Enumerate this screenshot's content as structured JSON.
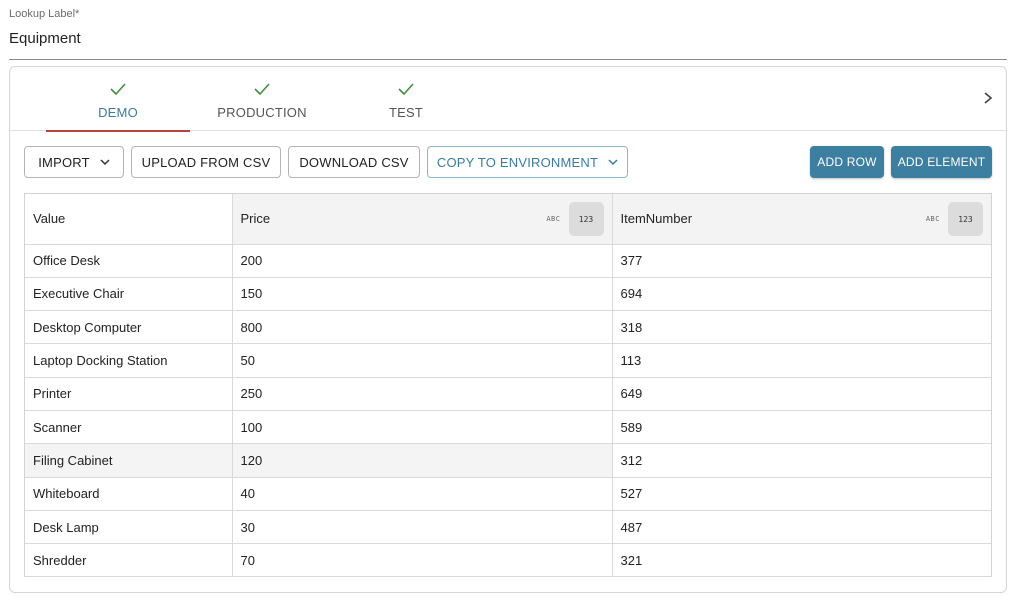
{
  "lookup": {
    "caption": "Lookup Label*",
    "value": "Equipment"
  },
  "tabs": [
    {
      "label": "DEMO",
      "icon": "check-icon",
      "active": true
    },
    {
      "label": "PRODUCTION",
      "icon": "check-icon",
      "active": false
    },
    {
      "label": "TEST",
      "icon": "check-icon",
      "active": false
    }
  ],
  "toolbar": {
    "import_label": "IMPORT",
    "upload_label": "UPLOAD FROM CSV",
    "download_label": "DOWNLOAD CSV",
    "copy_label": "COPY TO ENVIRONMENT",
    "add_row_label": "ADD ROW",
    "add_element_label": "ADD ELEMENT"
  },
  "colors": {
    "accent": "#3d7fa0",
    "active_tab_underline": "#b94141",
    "check": "#3f8f3f"
  },
  "table": {
    "columns": [
      {
        "label": "Value"
      },
      {
        "label": "Price",
        "type_abc": "ABC",
        "type_num": "123"
      },
      {
        "label": "ItemNumber",
        "type_abc": "ABC",
        "type_num": "123"
      }
    ],
    "rows": [
      [
        "Office Desk",
        "200",
        "377"
      ],
      [
        "Executive Chair",
        "150",
        "694"
      ],
      [
        "Desktop Computer",
        "800",
        "318"
      ],
      [
        "Laptop Docking Station",
        "50",
        "113"
      ],
      [
        "Printer",
        "250",
        "649"
      ],
      [
        "Scanner",
        "100",
        "589"
      ],
      [
        "Filing Cabinet",
        "120",
        "312"
      ],
      [
        "Whiteboard",
        "40",
        "527"
      ],
      [
        "Desk Lamp",
        "30",
        "487"
      ],
      [
        "Shredder",
        "70",
        "321"
      ]
    ]
  }
}
